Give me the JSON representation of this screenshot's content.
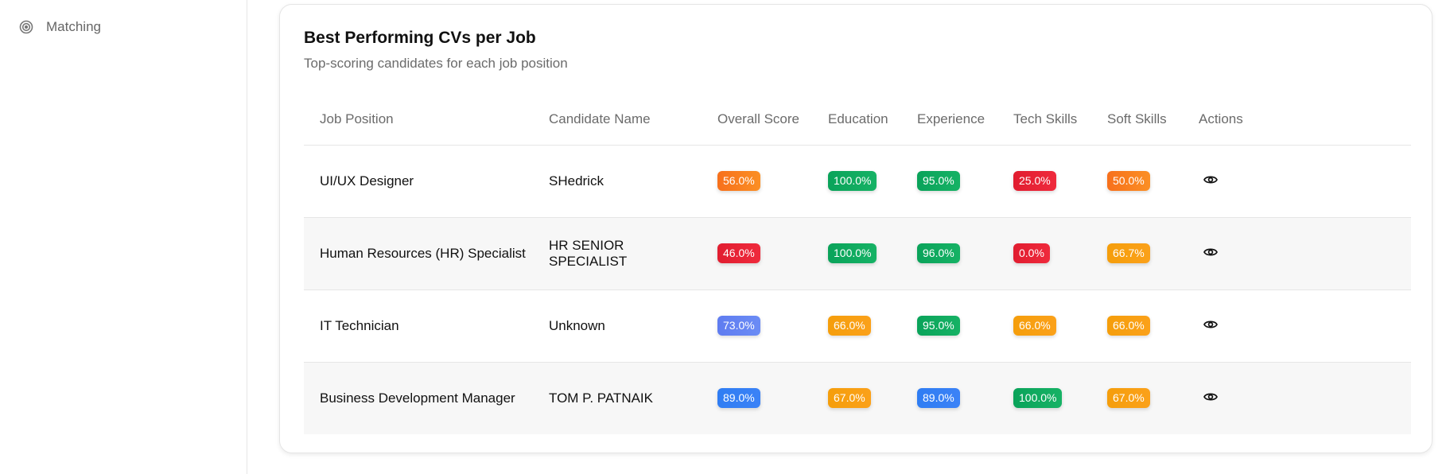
{
  "sidebar": {
    "items": [
      {
        "label": "Matching",
        "icon": "target-icon"
      }
    ]
  },
  "card": {
    "title": "Best Performing CVs per Job",
    "subtitle": "Top-scoring candidates for each job position"
  },
  "table": {
    "columns": [
      "Job Position",
      "Candidate Name",
      "Overall Score",
      "Education",
      "Experience",
      "Tech Skills",
      "Soft Skills",
      "Actions"
    ],
    "rows": [
      {
        "job": "UI/UX Designer",
        "candidate": "SHedrick",
        "overall": "56.0%",
        "education": "100.0%",
        "experience": "95.0%",
        "tech": "25.0%",
        "soft": "50.0%",
        "colors": {
          "overall": "orange",
          "education": "green",
          "experience": "green",
          "tech": "red",
          "soft": "orange"
        }
      },
      {
        "job": "Human Resources (HR) Specialist",
        "candidate": "HR SENIOR SPECIALIST",
        "overall": "46.0%",
        "education": "100.0%",
        "experience": "96.0%",
        "tech": "0.0%",
        "soft": "66.7%",
        "colors": {
          "overall": "red",
          "education": "green",
          "experience": "green",
          "tech": "red",
          "soft": "amber"
        }
      },
      {
        "job": "IT Technician",
        "candidate": "Unknown",
        "overall": "73.0%",
        "education": "66.0%",
        "experience": "95.0%",
        "tech": "66.0%",
        "soft": "66.0%",
        "colors": {
          "overall": "indigo",
          "education": "amber",
          "experience": "green",
          "tech": "amber",
          "soft": "amber"
        }
      },
      {
        "job": "Business Development Manager",
        "candidate": "TOM P. PATNAIK",
        "overall": "89.0%",
        "education": "67.0%",
        "experience": "89.0%",
        "tech": "100.0%",
        "soft": "67.0%",
        "colors": {
          "overall": "blue",
          "education": "amber",
          "experience": "blue",
          "tech": "green",
          "soft": "amber"
        }
      }
    ],
    "action_icon": "eye-icon"
  },
  "colors": {
    "orange": "#f7701c",
    "amber": "#f59e0b",
    "red": "#e11d30",
    "green": "#0aa35a",
    "blue": "#2f7df3",
    "indigo": "#5f7cf0"
  }
}
